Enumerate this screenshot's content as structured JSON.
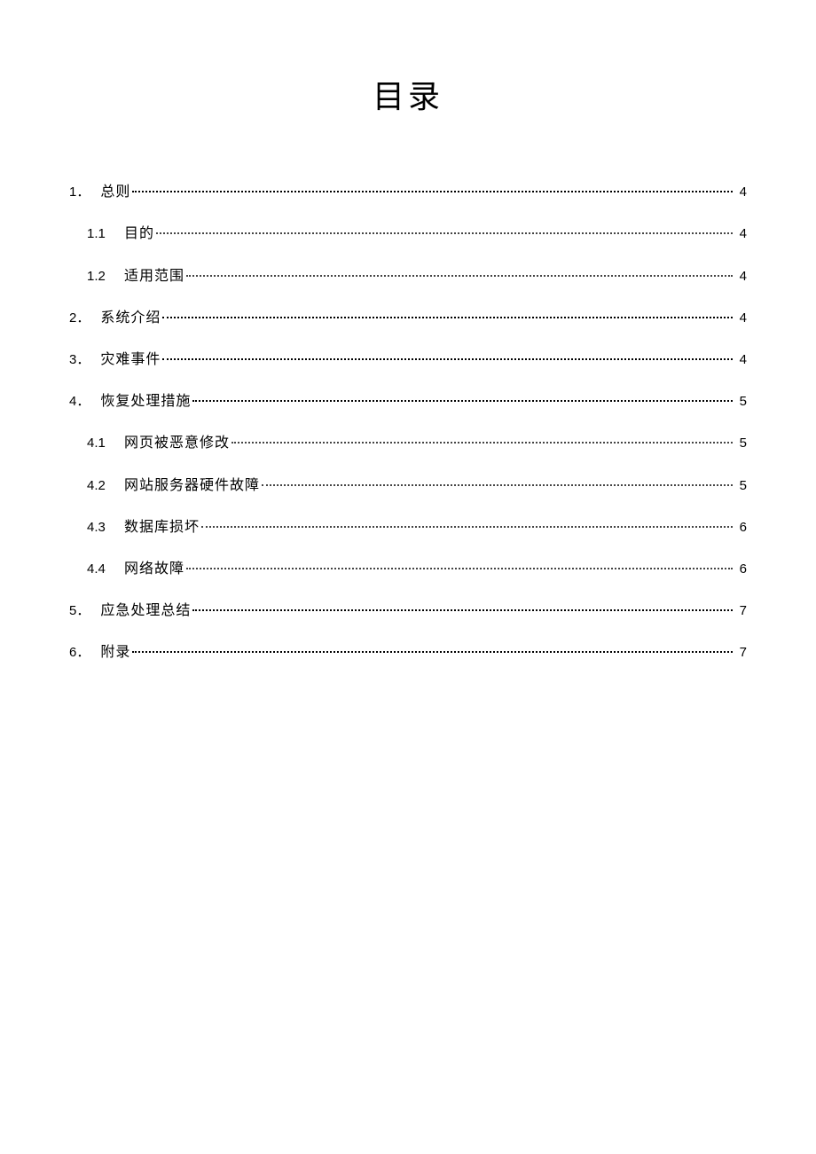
{
  "title": "目录",
  "toc": [
    {
      "level": 1,
      "num": "1",
      "sep": "．",
      "label": "总则",
      "page": "4"
    },
    {
      "level": 2,
      "num": "1.1",
      "sep": "",
      "label": "目的",
      "page": "4"
    },
    {
      "level": 2,
      "num": "1.2",
      "sep": "",
      "label": "适用范围",
      "page": "4"
    },
    {
      "level": 1,
      "num": "2",
      "sep": "．",
      "label": "系统介绍",
      "page": "4"
    },
    {
      "level": 1,
      "num": "3",
      "sep": "．",
      "label": "灾难事件",
      "page": "4"
    },
    {
      "level": 1,
      "num": "4",
      "sep": "．",
      "label": "恢复处理措施",
      "page": "5"
    },
    {
      "level": 2,
      "num": "4.1",
      "sep": "",
      "label": "网页被恶意修改",
      "page": "5"
    },
    {
      "level": 2,
      "num": "4.2",
      "sep": "",
      "label": "网站服务器硬件故障",
      "page": "5"
    },
    {
      "level": 2,
      "num": "4.3",
      "sep": "",
      "label": "数据库损坏",
      "page": "6"
    },
    {
      "level": 2,
      "num": "4.4",
      "sep": "",
      "label": "网络故障",
      "page": "6"
    },
    {
      "level": 1,
      "num": "5",
      "sep": "．",
      "label": "应急处理总结",
      "page": "7"
    },
    {
      "level": 1,
      "num": "6",
      "sep": "．",
      "label": "附录",
      "page": "7"
    }
  ]
}
